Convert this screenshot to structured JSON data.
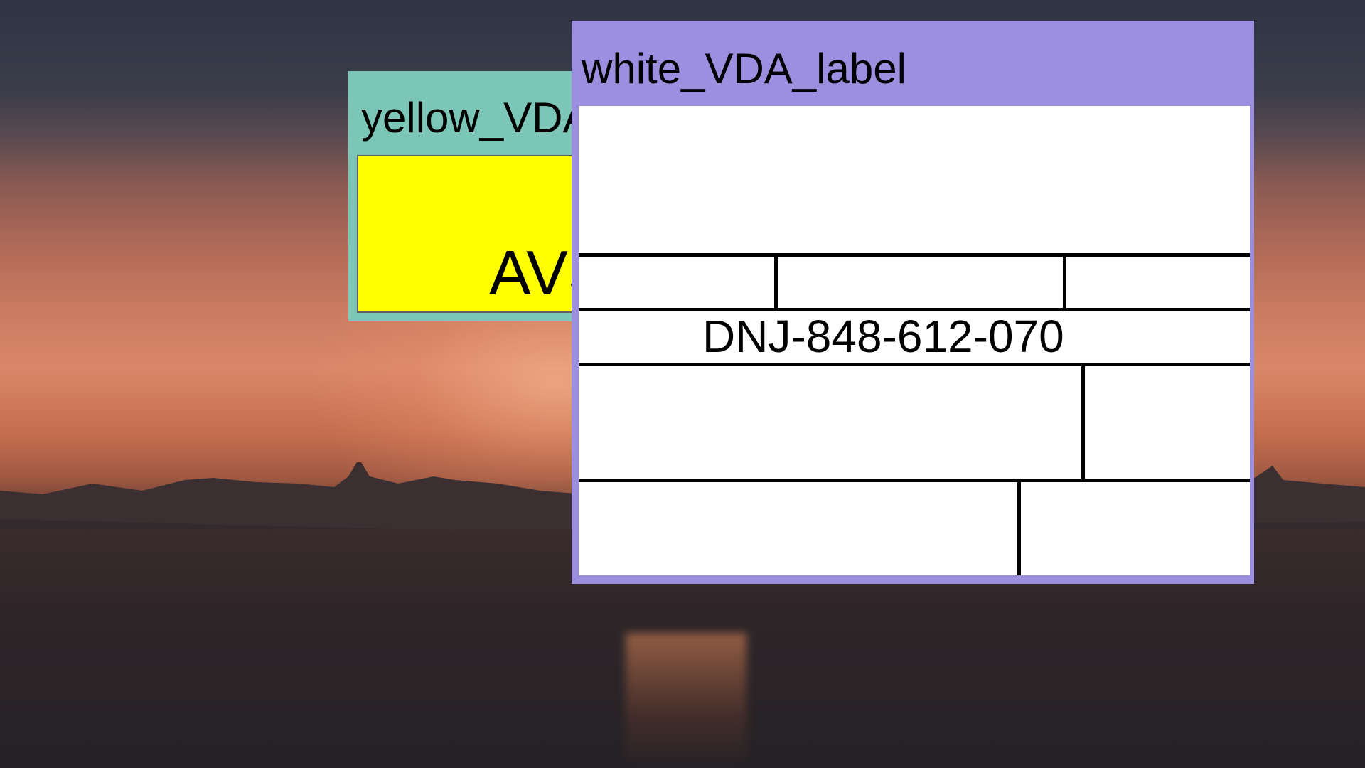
{
  "windows": {
    "yellow": {
      "title": "yellow_VDA_label",
      "code": "AVS"
    },
    "white": {
      "title": "white_VDA_label",
      "code": "DNJ-848-612-070"
    }
  },
  "colors": {
    "yellow_frame": "#7bc6b6",
    "yellow_label": "#ffff00",
    "white_frame": "#9d8fe0",
    "white_label": "#ffffff"
  }
}
